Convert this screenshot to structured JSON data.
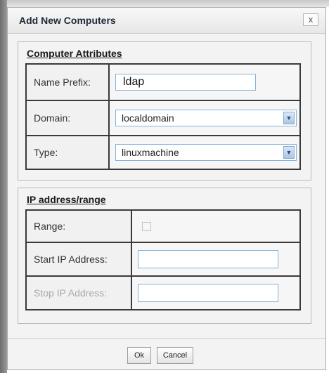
{
  "dialog": {
    "title": "Add New Computers",
    "close_label": "x"
  },
  "attributes": {
    "legend": "Computer Attributes",
    "name_prefix_label": "Name Prefix:",
    "name_prefix_value": "ldap",
    "domain_label": "Domain:",
    "domain_value": "localdomain",
    "type_label": "Type:",
    "type_value": "linuxmachine"
  },
  "ip": {
    "legend": "IP address/range",
    "range_label": "Range:",
    "range_checked": false,
    "start_label": "Start IP Address:",
    "start_value": "",
    "stop_label": "Stop IP Address:",
    "stop_value": ""
  },
  "footer": {
    "ok_label": "Ok",
    "cancel_label": "Cancel"
  },
  "colors": {
    "input_border": "#86b3d8",
    "dialog_bg": "#f3f3f3",
    "disabled_text": "#a9a9a9"
  }
}
